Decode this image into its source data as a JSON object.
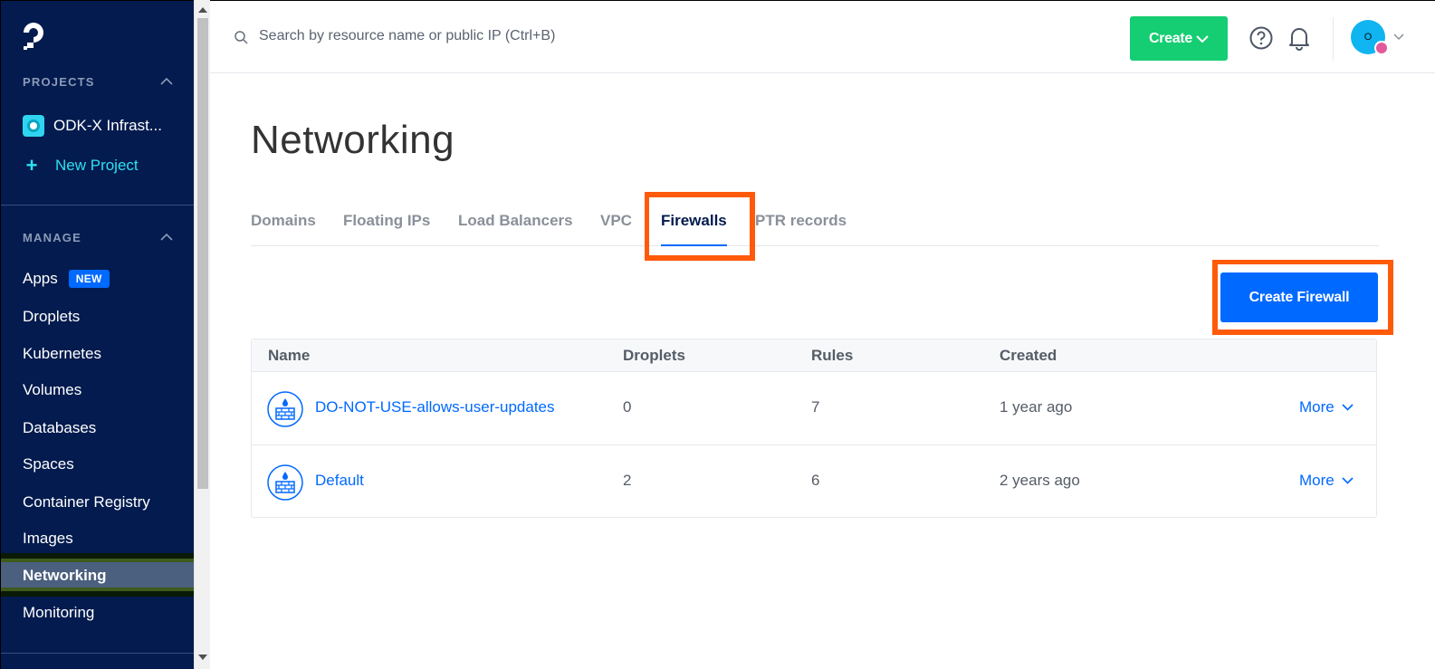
{
  "sidebar": {
    "projects_heading": "PROJECTS",
    "project_name": "ODK-X Infrast...",
    "new_project": "New Project",
    "manage_heading": "MANAGE",
    "new_badge": "NEW",
    "items": [
      {
        "label": "Apps"
      },
      {
        "label": "Droplets"
      },
      {
        "label": "Kubernetes"
      },
      {
        "label": "Volumes"
      },
      {
        "label": "Databases"
      },
      {
        "label": "Spaces"
      },
      {
        "label": "Container Registry"
      },
      {
        "label": "Images"
      },
      {
        "label": "Networking"
      },
      {
        "label": "Monitoring"
      }
    ],
    "active_item": "Networking"
  },
  "topbar": {
    "search_placeholder": "Search by resource name or public IP (Ctrl+B)",
    "create_label": "Create",
    "avatar_initial": "O"
  },
  "page": {
    "title": "Networking",
    "tabs": [
      {
        "label": "Domains"
      },
      {
        "label": "Floating IPs"
      },
      {
        "label": "Load Balancers"
      },
      {
        "label": "VPC"
      },
      {
        "label": "Firewalls"
      },
      {
        "label": "PTR records"
      }
    ],
    "active_tab": "Firewalls",
    "create_firewall_label": "Create Firewall"
  },
  "table": {
    "columns": [
      "Name",
      "Droplets",
      "Rules",
      "Created"
    ],
    "rows": [
      {
        "name": "DO-NOT-USE-allows-user-updates",
        "droplets": "0",
        "rules": "7",
        "created": "1 year ago",
        "action": "More"
      },
      {
        "name": "Default",
        "droplets": "2",
        "rules": "6",
        "created": "2 years ago",
        "action": "More"
      }
    ]
  },
  "colors": {
    "sidebar_bg": "#031b4e",
    "accent_blue": "#0069ff",
    "create_green": "#15cd72",
    "highlight_orange": "#ff5a0a",
    "project_cyan": "#2ce0f2"
  }
}
